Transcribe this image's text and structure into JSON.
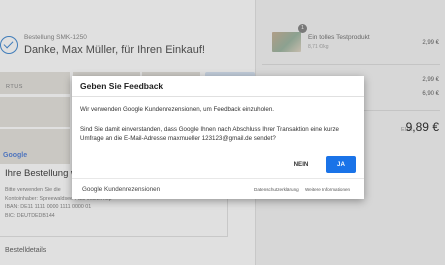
{
  "order": {
    "number_label": "Bestellung SMK-1250",
    "thanks": "Danke, Max Müller, für Ihren Einkauf!"
  },
  "map": {
    "street_label": "RTUS",
    "google_logo": "Google"
  },
  "payment": {
    "heading": "Ihre Bestellung wu",
    "lines": [
      "Bitte verwenden Sie die",
      "Kontoinhaber: Spreewaldsee Paul Musterhop",
      "IBAN: DE11 1111 0000 1111 0000 01",
      "BIC: DEUTDEDB144"
    ]
  },
  "details": {
    "heading": "Bestelldetails"
  },
  "cart": {
    "quantity": "1",
    "product_name": "Ein tolles Testprodukt",
    "product_sub": "8,71 €/kg",
    "product_price": "2,99 €",
    "subtotal": "2,99 €",
    "shipping": "6,90 €",
    "total_label": "EUR",
    "total": "9,89 €"
  },
  "dialog": {
    "title": "Geben Sie Feedback",
    "intro": "Wir verwenden Google Kundenrezensionen, um Feedback einzuholen.",
    "question": "Sind Sie damit einverstanden, dass Google Ihnen nach Abschluss Ihrer Transaktion eine kurze Umfrage an die E-Mail-Adresse maxmueller 123123@gmail.de sendet?",
    "no_label": "NEIN",
    "yes_label": "JA",
    "brand": "Google Kundenrezensionen",
    "privacy_link": "Datenschutzerklärung",
    "more_link": "Weitere Informationen"
  },
  "colors": {
    "accent": "#1a73e8",
    "check": "#4a8fd4"
  }
}
